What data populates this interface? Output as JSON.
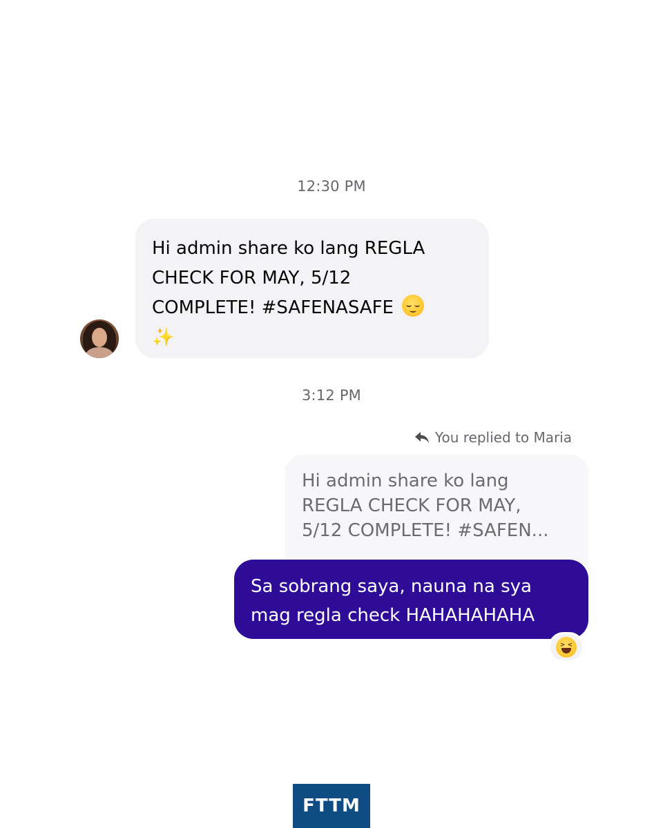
{
  "thread": {
    "timestamps": [
      "12:30 PM",
      "3:12 PM"
    ],
    "incoming_message": {
      "lines": [
        "Hi admin share ko lang REGLA",
        "CHECK FOR MAY, 5/12",
        "COMPLETE! #SAFENASAFE"
      ],
      "emoji": "relieved-face",
      "sparkles": "✨"
    },
    "reply_label": "You replied to Maria",
    "quoted_message": {
      "lines": [
        "Hi admin share ko lang",
        "REGLA CHECK FOR MAY,",
        "5/12 COMPLETE! #SAFEN..."
      ]
    },
    "outgoing_message": {
      "lines": [
        "Sa sobrang saya, nauna na sya",
        "mag regla check HAHAHAHAHA"
      ]
    },
    "reaction": "grinning-squinting-face"
  },
  "branding": {
    "logo_text": "FTTM"
  },
  "colors": {
    "incoming_bubble": "#f3f3f6",
    "outgoing_bubble": "#2f0c98",
    "timestamp_text": "#65676b",
    "logo_background": "#0e4c83"
  }
}
